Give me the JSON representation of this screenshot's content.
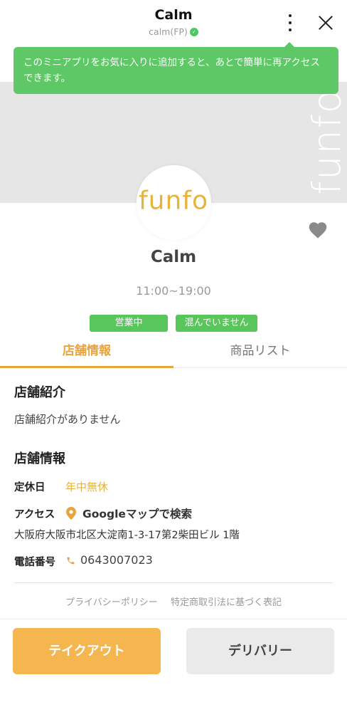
{
  "header": {
    "title": "Calm",
    "subtitle": "calm(FP)",
    "verified_icon": "verified-badge-icon"
  },
  "tooltip": {
    "text": "このミニアプリをお気に入りに追加すると、あとで簡単に再アクセスできます。"
  },
  "banner": {
    "watermark": "funfo"
  },
  "store": {
    "logo_text": "funfo",
    "name": "Calm",
    "hours": "11:00~19:00",
    "badges": [
      "営業中",
      "混んでいません"
    ]
  },
  "tabs": [
    {
      "label": "店舗情報",
      "active": true
    },
    {
      "label": "商品リスト",
      "active": false
    }
  ],
  "intro": {
    "heading": "店舗紹介",
    "text": "店舗紹介がありません"
  },
  "info": {
    "heading": "店舗情報",
    "holiday_label": "定休日",
    "holiday_value": "年中無休",
    "access_label": "アクセス",
    "map_link": "Googleマップで検索",
    "address": "大阪府大阪市北区大淀南1-3-17第2柴田ビル 1階",
    "phone_label": "電話番号",
    "phone": "0643007023"
  },
  "footer": {
    "links": [
      "プライバシーポリシー",
      "特定商取引法に基づく表記"
    ]
  },
  "actions": {
    "takeout": "テイクアウト",
    "delivery": "デリバリー"
  },
  "colors": {
    "accent": "#e8a33d",
    "green": "#58c65a",
    "takeout_button": "#f5b54f"
  }
}
